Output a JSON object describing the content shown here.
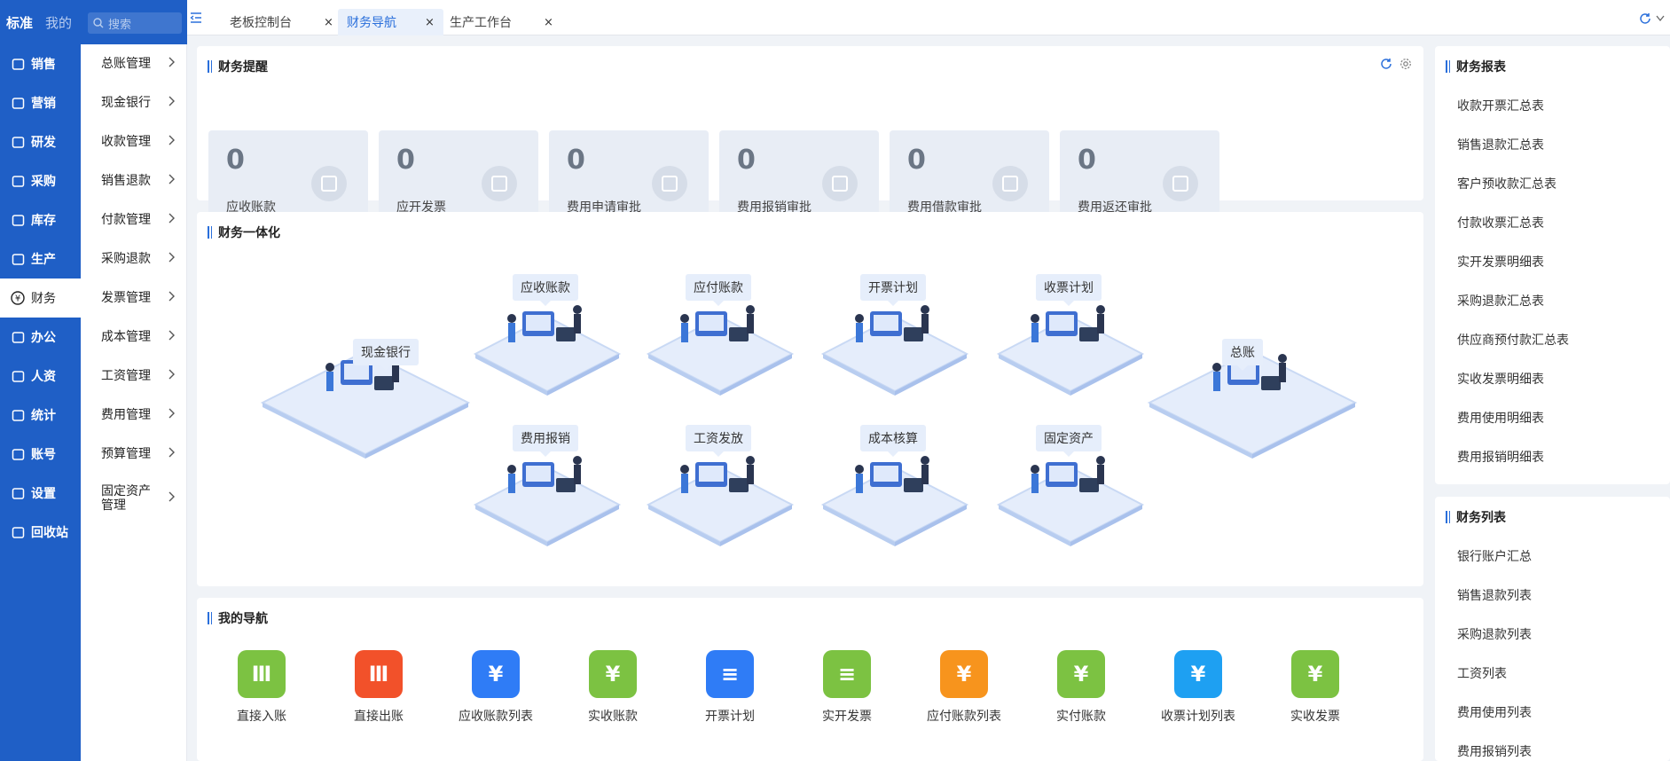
{
  "sidebar": {
    "tabs": [
      "标准",
      "我的"
    ],
    "items": [
      "销售",
      "营销",
      "研发",
      "采购",
      "库存",
      "生产",
      "财务",
      "办公",
      "人资",
      "统计",
      "账号",
      "设置",
      "回收站"
    ],
    "active": "财务"
  },
  "search": {
    "placeholder": "搜索"
  },
  "submenu": [
    "总账管理",
    "现金银行",
    "收款管理",
    "销售退款",
    "付款管理",
    "采购退款",
    "发票管理",
    "成本管理",
    "工资管理",
    "费用管理",
    "预算管理",
    "固定资产管理"
  ],
  "tabs": [
    {
      "label": "老板控制台",
      "close": "×"
    },
    {
      "label": "财务导航",
      "close": "×",
      "active": true
    },
    {
      "label": "生产工作台",
      "close": "×"
    }
  ],
  "reminder": {
    "title": "财务提醒",
    "cards": [
      {
        "num": "0",
        "label": "应收账款"
      },
      {
        "num": "0",
        "label": "应开发票"
      },
      {
        "num": "0",
        "label": "费用申请审批"
      },
      {
        "num": "0",
        "label": "费用报销审批"
      },
      {
        "num": "0",
        "label": "费用借款审批"
      },
      {
        "num": "0",
        "label": "费用返还审批"
      }
    ]
  },
  "integration": {
    "title": "财务一体化",
    "modules": [
      "现金银行",
      "应收账款",
      "应付账款",
      "开票计划",
      "收票计划",
      "总账",
      "费用报销",
      "工资发放",
      "成本核算",
      "固定资产"
    ]
  },
  "mynav": {
    "title": "我的导航",
    "items": [
      {
        "label": "直接入账",
        "color": "#7cc242",
        "icon": "bank-in-icon"
      },
      {
        "label": "直接出账",
        "color": "#f2512a",
        "icon": "bank-out-icon"
      },
      {
        "label": "应收账款列表",
        "color": "#2f7cf6",
        "icon": "yen-down-icon"
      },
      {
        "label": "实收账款",
        "color": "#7cc242",
        "icon": "yen-check-icon"
      },
      {
        "label": "开票计划",
        "color": "#2f7cf6",
        "icon": "invoice-icon"
      },
      {
        "label": "实开发票",
        "color": "#7cc242",
        "icon": "invoice-check-icon"
      },
      {
        "label": "应付账款列表",
        "color": "#f7941d",
        "icon": "yen-house-icon"
      },
      {
        "label": "实付账款",
        "color": "#7cc242",
        "icon": "yen-house-check-icon"
      },
      {
        "label": "收票计划列表",
        "color": "#1ea0f2",
        "icon": "ticket-icon"
      },
      {
        "label": "实收发票",
        "color": "#7cc242",
        "icon": "ticket-check-icon"
      }
    ]
  },
  "reports": {
    "title": "财务报表",
    "items": [
      "收款开票汇总表",
      "销售退款汇总表",
      "客户预收款汇总表",
      "付款收票汇总表",
      "实开发票明细表",
      "采购退款汇总表",
      "供应商预付款汇总表",
      "实收发票明细表",
      "费用使用明细表",
      "费用报销明细表"
    ]
  },
  "lists": {
    "title": "财务列表",
    "items": [
      "银行账户汇总",
      "销售退款列表",
      "采购退款列表",
      "工资列表",
      "费用使用列表",
      "费用报销列表"
    ]
  }
}
